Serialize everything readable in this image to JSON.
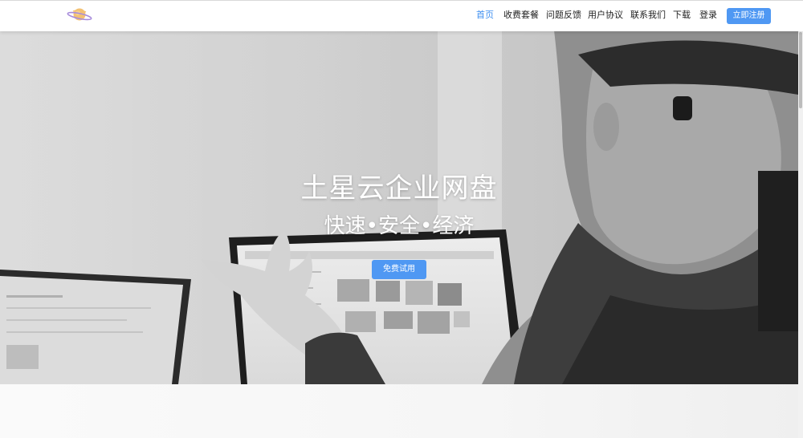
{
  "header": {
    "logo_icon": "planet-logo-icon",
    "nav": [
      {
        "label": "首页",
        "active": true
      },
      {
        "label": "收费套餐",
        "active": false
      },
      {
        "label": "问题反馈",
        "active": false
      },
      {
        "label": "用户协议",
        "active": false
      },
      {
        "label": "联系我们",
        "active": false
      },
      {
        "label": "下载",
        "active": false
      },
      {
        "label": "登录",
        "active": false
      }
    ],
    "register_label": "立即注册"
  },
  "hero": {
    "title": "土星云企业网盘",
    "subtitle": "快速•安全•经济",
    "trial_label": "免费试用",
    "background": "grayscale-photo-person-with-laptops"
  },
  "colors": {
    "accent": "#4f98f3",
    "active_nav": "#3f8ff0",
    "text": "#222222"
  }
}
